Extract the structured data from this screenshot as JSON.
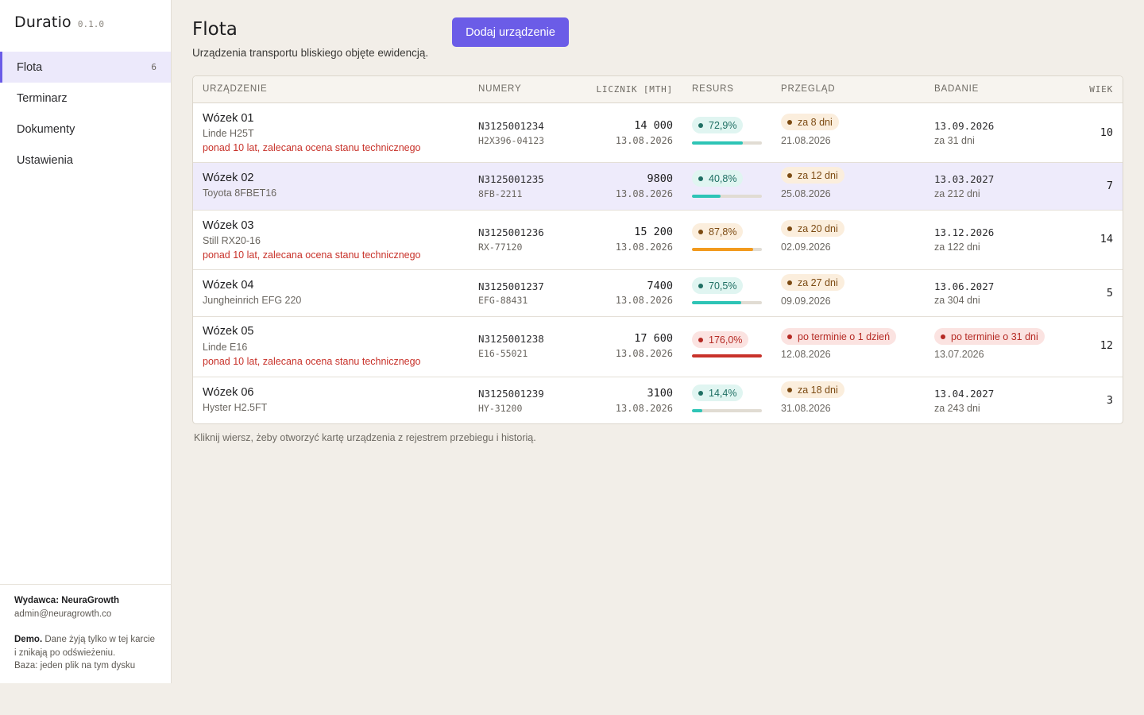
{
  "app": {
    "name": "Duratio",
    "version": "0.1.0"
  },
  "sidebar": {
    "items": [
      {
        "label": "Flota",
        "count": "6"
      },
      {
        "label": "Terminarz"
      },
      {
        "label": "Dokumenty"
      },
      {
        "label": "Ustawienia"
      }
    ],
    "footer": {
      "publisher": "Wydawca: NeuraGrowth",
      "email": "admin@neuragrowth.co",
      "demo_label": "Demo.",
      "demo_text_1": "Dane żyją tylko w tej karcie",
      "demo_text_2": "i znikają po odświeżeniu.",
      "db_text": "Baza: jeden plik na tym dysku"
    }
  },
  "header": {
    "title": "Flota",
    "subtitle": "Urządzenia transportu bliskiego objęte ewidencją.",
    "add_button": "Dodaj urządzenie"
  },
  "table": {
    "headers": {
      "device": "URZĄDZENIE",
      "numbers": "NUMERY",
      "counter": "LICZNIK [MTH]",
      "resource": "RESURS",
      "inspection": "PRZEGLĄD",
      "exam": "BADANIE",
      "age": "WIEK"
    },
    "rows": [
      {
        "name": "Wózek 01",
        "model": "Linde H25T",
        "warning": "ponad 10 lat, zalecana ocena stanu technicznego",
        "serial": "N3125001234",
        "reg": "H2X396-04123",
        "counter": "14 000",
        "counter_date": "13.08.2026",
        "resource": "72,9%",
        "resource_fraction": 0.729,
        "resource_status": "ok",
        "inspection_badge": "za 8 dni",
        "inspection_date": "21.08.2026",
        "exam_date": "13.09.2026",
        "exam_sub": "za 31 dni",
        "exam_status": "normal",
        "age": "10"
      },
      {
        "name": "Wózek 02",
        "model": "Toyota 8FBET16",
        "warning": "",
        "serial": "N3125001235",
        "reg": "8FB-2211",
        "counter": "9800",
        "counter_date": "13.08.2026",
        "resource": "40,8%",
        "resource_fraction": 0.408,
        "resource_status": "ok",
        "inspection_badge": "za 12 dni",
        "inspection_date": "25.08.2026",
        "exam_date": "13.03.2027",
        "exam_sub": "za 212 dni",
        "exam_status": "normal",
        "age": "7"
      },
      {
        "name": "Wózek 03",
        "model": "Still RX20-16",
        "warning": "ponad 10 lat, zalecana ocena stanu technicznego",
        "serial": "N3125001236",
        "reg": "RX-77120",
        "counter": "15 200",
        "counter_date": "13.08.2026",
        "resource": "87,8%",
        "resource_fraction": 0.878,
        "resource_status": "warn",
        "inspection_badge": "za 20 dni",
        "inspection_date": "02.09.2026",
        "exam_date": "13.12.2026",
        "exam_sub": "za 122 dni",
        "exam_status": "normal",
        "age": "14"
      },
      {
        "name": "Wózek 04",
        "model": "Jungheinrich EFG 220",
        "warning": "",
        "serial": "N3125001237",
        "reg": "EFG-88431",
        "counter": "7400",
        "counter_date": "13.08.2026",
        "resource": "70,5%",
        "resource_fraction": 0.705,
        "resource_status": "ok",
        "inspection_badge": "za 27 dni",
        "inspection_date": "09.09.2026",
        "exam_date": "13.06.2027",
        "exam_sub": "za 304 dni",
        "exam_status": "normal",
        "age": "5"
      },
      {
        "name": "Wózek 05",
        "model": "Linde E16",
        "warning": "ponad 10 lat, zalecana ocena stanu technicznego",
        "serial": "N3125001238",
        "reg": "E16-55021",
        "counter": "17 600",
        "counter_date": "13.08.2026",
        "resource": "176,0%",
        "resource_fraction": 1.0,
        "resource_status": "bad",
        "inspection_badge": "po terminie o 1 dzień",
        "inspection_date": "12.08.2026",
        "exam_badge": "po terminie o 31 dni",
        "exam_date": "13.07.2026",
        "exam_status": "overdue",
        "age": "12"
      },
      {
        "name": "Wózek 06",
        "model": "Hyster H2.5FT",
        "warning": "",
        "serial": "N3125001239",
        "reg": "HY-31200",
        "counter": "3100",
        "counter_date": "13.08.2026",
        "resource": "14,4%",
        "resource_fraction": 0.144,
        "resource_status": "ok",
        "inspection_badge": "za 18 dni",
        "inspection_date": "31.08.2026",
        "exam_date": "13.04.2027",
        "exam_sub": "za 243 dni",
        "exam_status": "normal",
        "age": "3"
      }
    ],
    "hint": "Kliknij wiersz, żeby otworzyć kartę urządzenia z rejestrem przebiegu i historią."
  },
  "colors": {
    "accent": "#6b5ce7",
    "ok": "#2ec4b6",
    "warn": "#f29a1e",
    "bad": "#c8322a"
  }
}
